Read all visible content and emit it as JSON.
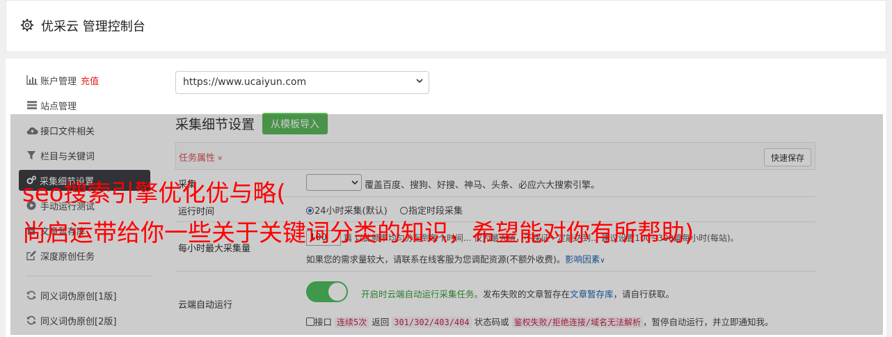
{
  "header": {
    "title": "优采云 管理控制台"
  },
  "sidebar": {
    "items": [
      {
        "label": "账户管理",
        "extra": "充值",
        "icon": "bar-chart-icon"
      },
      {
        "label": "站点管理",
        "icon": "server-icon"
      },
      {
        "label": "接口文件相关",
        "icon": "cloud-upload-icon"
      },
      {
        "label": "栏目与关键词",
        "icon": "filter-icon"
      },
      {
        "label": "采集细节设置",
        "icon": "cogs-icon"
      },
      {
        "label": "手动运行测试",
        "icon": "play-circle-icon"
      },
      {
        "label": "文章暂存库",
        "icon": "archive-icon"
      },
      {
        "label": "深度原创任务",
        "icon": "edit-icon"
      },
      {
        "label": "同义词伪原创[1版]",
        "icon": "refresh-icon"
      },
      {
        "label": "同义词伪原创[2版]",
        "icon": "refresh-icon"
      }
    ]
  },
  "site_select": {
    "value": "https://www.ucaiyun.com"
  },
  "section": {
    "title": "采集细节设置",
    "import_button": "从模板导入"
  },
  "task_bar": {
    "label": "任务属性",
    "chevron": "»",
    "save_button": "快速保存"
  },
  "rows": {
    "engine": {
      "label": "采集",
      "desc": "覆盖百度、搜狗、好搜、神马、头条、必应六大搜索引擎。"
    },
    "runtime": {
      "label": "运行时间",
      "opt1": "24小时采集(默认)",
      "opt2": "指定时段采集"
    },
    "max": {
      "label": "每小时最大采集量",
      "value": "100",
      "desc": "篇 以此频率均匀分配到每个时间... 仅为最大值，不保证一定能达到... 建议设置100~300篇每小时(每站)。",
      "note": "如果您的需求量较大，请联系在线客服为您调配资源(不额外收费)。",
      "link": "影响因素"
    },
    "cloud": {
      "label": "云端自动运行",
      "desc_green": "开启时云端自动运行采集任务。",
      "desc_a": "发布失败的文章暂存在",
      "desc_link": "文章暂存库",
      "desc_b": "，请自行获取。",
      "cb_label": "接口",
      "code1": "连续5次",
      "txt1": "返回",
      "code2": "301/302/403/404",
      "txt2": "状态码或",
      "code3": "鉴权失败/拒绝连接/域名无法解析",
      "txt3": "，暂停自动运行，并立即通知我。"
    }
  },
  "watermark": {
    "line1": "seo搜索引擎优化优与略(",
    "line2": "尚启运带给你一些关于关键词分类的知识，希望能对你有所帮助)"
  },
  "colors": {
    "accent_green": "#5cb85c",
    "active_sidebar": "#3c3f44",
    "danger": "#e02020",
    "watermark": "#ff0000"
  }
}
